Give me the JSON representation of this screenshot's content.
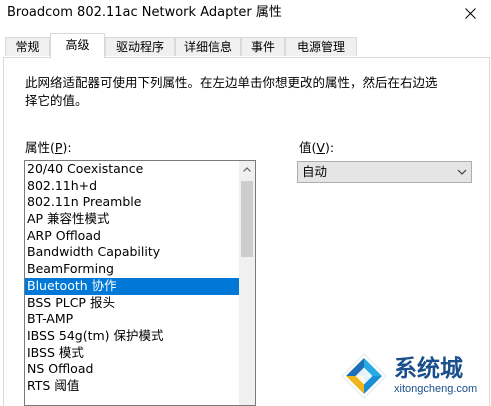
{
  "window": {
    "title": "Broadcom 802.11ac Network Adapter 属性"
  },
  "tabs": [
    {
      "label": "常规"
    },
    {
      "label": "高级"
    },
    {
      "label": "驱动程序"
    },
    {
      "label": "详细信息"
    },
    {
      "label": "事件"
    },
    {
      "label": "电源管理"
    }
  ],
  "active_tab": "高级",
  "description": "此网络适配器可使用下列属性。在左边单击你想更改的属性，然后在右边选择它的值。",
  "property_label": {
    "text": "属性(",
    "accel": "P",
    "suffix": "):"
  },
  "value_label": {
    "text": "值(",
    "accel": "V",
    "suffix": "):"
  },
  "properties": [
    "20/40 Coexistance",
    "802.11h+d",
    "802.11n Preamble",
    "AP 兼容性模式",
    "ARP Offload",
    "Bandwidth Capability",
    "BeamForming",
    "Bluetooth 协作",
    "BSS PLCP 报头",
    "BT-AMP",
    "IBSS 54g(tm) 保护模式",
    "IBSS 模式",
    "NS Offload",
    "RTS 阈值"
  ],
  "selected_property": "Bluetooth 协作",
  "value_select": {
    "selected": "自动"
  },
  "watermark": {
    "title": "系统城",
    "url": "xitongcheng.com"
  },
  "colors": {
    "selection": "#0078d7",
    "watermark": "#1a4f8c"
  }
}
